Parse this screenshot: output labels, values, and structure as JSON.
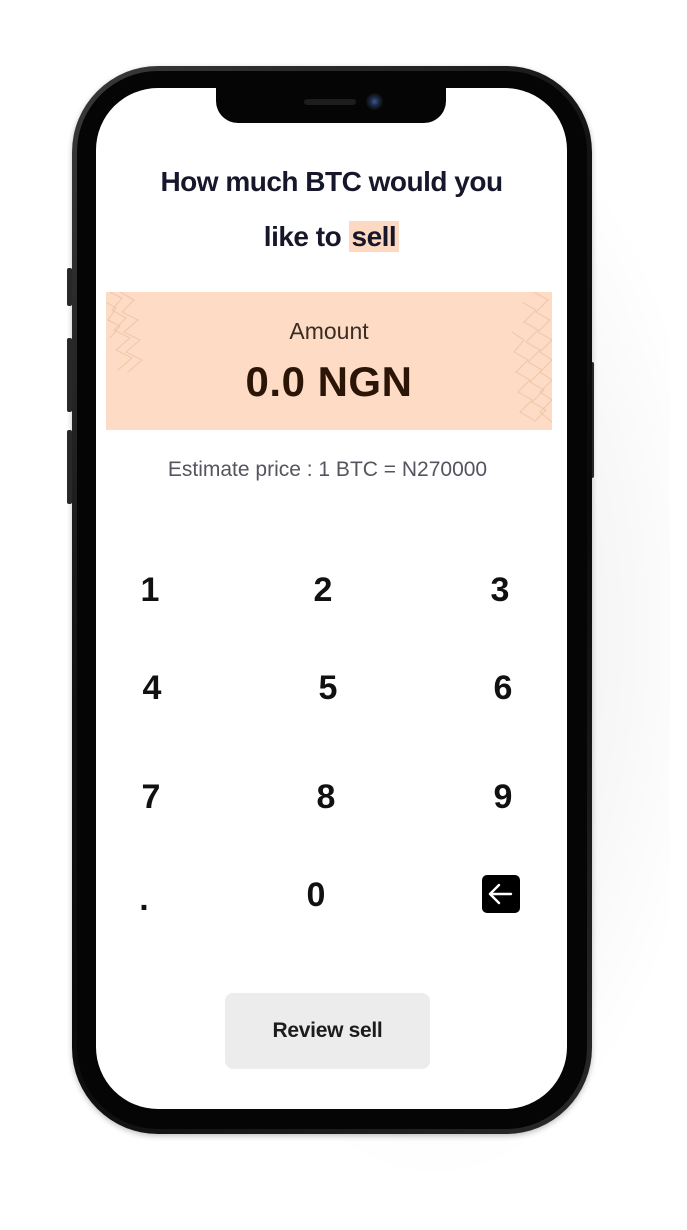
{
  "title": {
    "line1": "How much BTC would you",
    "line2_prefix": "like to ",
    "line2_highlight": "sell"
  },
  "amount": {
    "label": "Amount",
    "value": "0.0 NGN"
  },
  "estimate": "Estimate price : 1 BTC = N270000",
  "keypad": {
    "k1": "1",
    "k2": "2",
    "k3": "3",
    "k4": "4",
    "k5": "5",
    "k6": "6",
    "k7": "7",
    "k8": "8",
    "k9": "9",
    "dot": ".",
    "k0": "0",
    "backspace_icon": "arrow-left-icon"
  },
  "review_button": "Review sell",
  "colors": {
    "highlight": "#fdd9c1",
    "amount_box": "#fddbc4",
    "amount_text": "#2a1506",
    "title_text": "#16172b",
    "button_bg": "#ececec"
  }
}
